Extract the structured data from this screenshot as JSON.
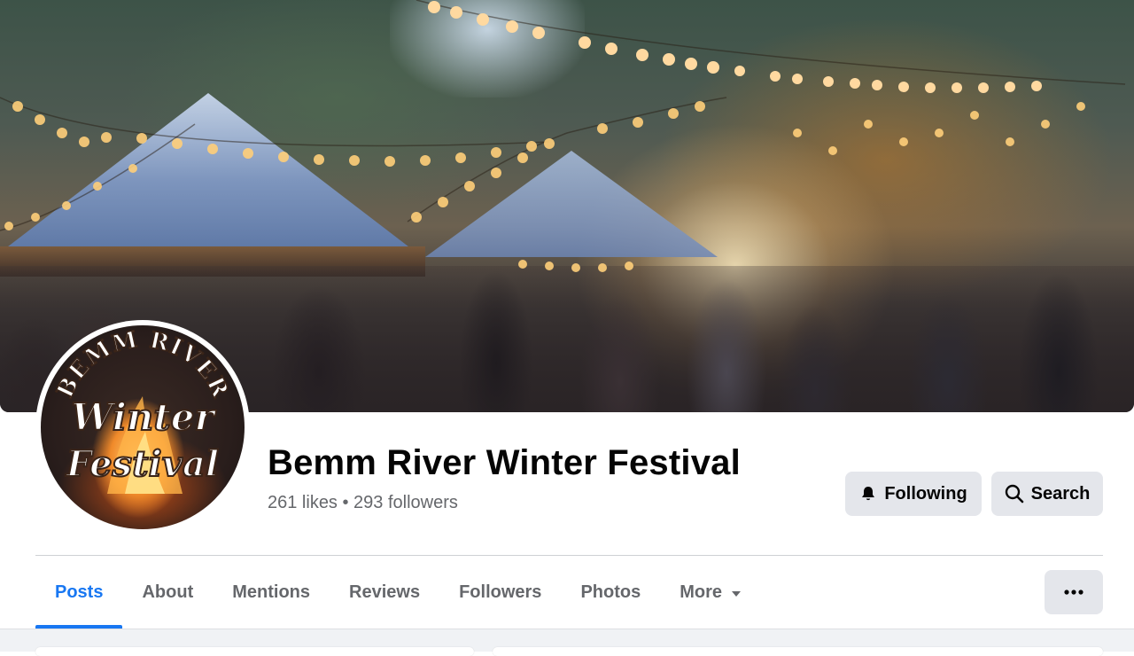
{
  "profile": {
    "name": "Bemm River Winter Festival",
    "stats": "261 likes • 293 followers",
    "avatar_text": [
      "BEMM RIVER",
      "Winter",
      "Festival"
    ]
  },
  "actions": {
    "following_label": "Following",
    "search_label": "Search"
  },
  "tabs": [
    {
      "label": "Posts",
      "active": true
    },
    {
      "label": "About"
    },
    {
      "label": "Mentions"
    },
    {
      "label": "Reviews"
    },
    {
      "label": "Followers"
    },
    {
      "label": "Photos"
    },
    {
      "label": "More"
    }
  ],
  "colors": {
    "accent": "#1877f2",
    "button_bg": "#e4e6eb",
    "secondary_text": "#65676b"
  },
  "icons": {
    "following": "bell-icon",
    "search": "search-icon",
    "more_caret": "caret-down-icon",
    "menu": "ellipsis-icon"
  }
}
